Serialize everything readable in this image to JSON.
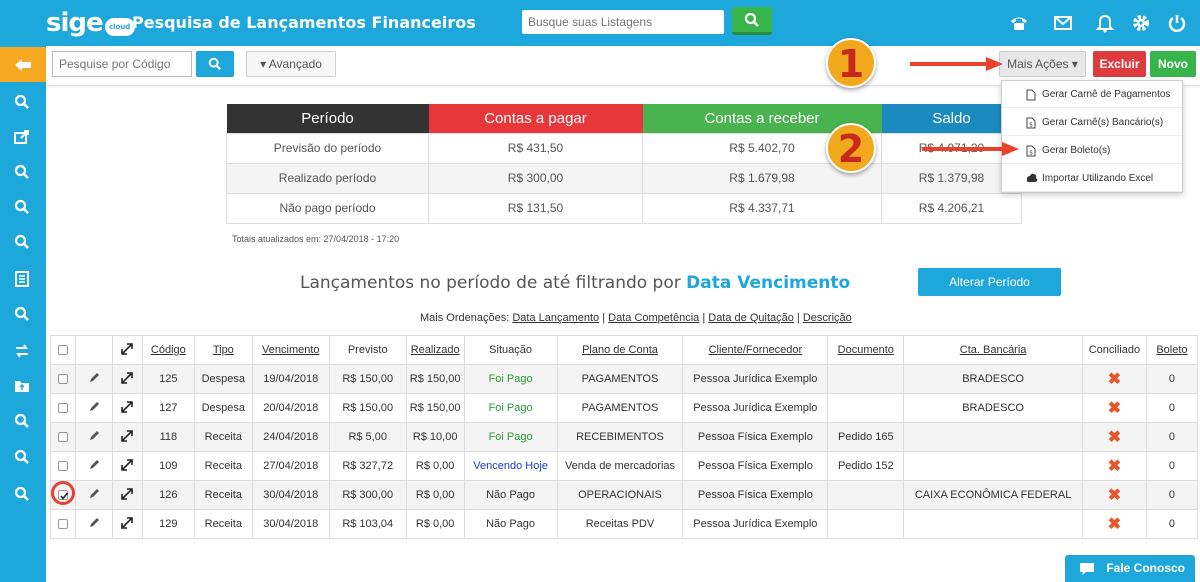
{
  "header": {
    "logo": "sige",
    "logo_badge": "cloud",
    "title": "Pesquisa de Lançamentos Financeiros",
    "search_placeholder": "Busque suas Listagens"
  },
  "toolbar": {
    "code_search_placeholder": "Pesquise por Código",
    "advanced_label": "▾ Avançado",
    "mais_acoes_label": "Mais Ações ▾",
    "excluir_label": "Excluir",
    "novo_label": "Novo"
  },
  "dropdown": {
    "items": [
      {
        "label": "Gerar Carnê de Pagamentos",
        "icon": "file-icon"
      },
      {
        "label": "Gerar Carnê(s) Bancário(s)",
        "icon": "file-dollar-icon"
      },
      {
        "label": "Gerar Boleto(s)",
        "icon": "file-dollar-icon"
      },
      {
        "label": "Importar Utilizando Excel",
        "icon": "cloud-upload-icon"
      }
    ]
  },
  "summary": {
    "headers": [
      "Período",
      "Contas a pagar",
      "Contas a receber",
      "Saldo"
    ],
    "header_colors": [
      "#333333",
      "#e8373a",
      "#48b34f",
      "#1b8bbf"
    ],
    "rows": [
      [
        "Previsão do período",
        "R$ 431,50",
        "R$ 5.402,70",
        "R$ 4.971,20"
      ],
      [
        "Realizado período",
        "R$ 300,00",
        "R$ 1.679,98",
        "R$ 1.379,98"
      ],
      [
        "Não pago período",
        "R$ 131,50",
        "R$ 4.337,71",
        "R$ 4.206,21"
      ]
    ],
    "totais": "Totais atualizados em: 27/04/2018 - 17:20"
  },
  "section": {
    "title_prefix": "Lançamentos no período de até filtrando por",
    "title_highlight": "Data Vencimento",
    "alterar_label": "Alterar Período",
    "ordenacoes_label": "Mais Ordenações:",
    "ordenacoes": [
      "Data Lançamento",
      "Data Competência",
      "Data de Quitação",
      "Descrição"
    ]
  },
  "table": {
    "columns": [
      "Código",
      "Tipo",
      "Vencimento",
      "Previsto",
      "Realizado",
      "Situação",
      "Plano de Conta",
      "Cliente/Fornecedor",
      "Documento",
      "Cta. Bancária",
      "Conciliado",
      "Boleto"
    ],
    "rows": [
      {
        "codigo": "125",
        "tipo": "Despesa",
        "vencimento": "19/04/2018",
        "previsto": "R$ 150,00",
        "realizado": "R$ 150,00",
        "situacao": "Foi Pago",
        "situacao_color": "#2a9d38",
        "plano": "PAGAMENTOS",
        "cliente": "Pessoa Jurídica Exemplo",
        "documento": "",
        "banco": "BRADESCO",
        "boleto": "0",
        "checked": false
      },
      {
        "codigo": "127",
        "tipo": "Despesa",
        "vencimento": "20/04/2018",
        "previsto": "R$ 150,00",
        "realizado": "R$ 150,00",
        "situacao": "Foi Pago",
        "situacao_color": "#2a9d38",
        "plano": "PAGAMENTOS",
        "cliente": "Pessoa Jurídica Exemplo",
        "documento": "",
        "banco": "BRADESCO",
        "boleto": "0",
        "checked": false
      },
      {
        "codigo": "118",
        "tipo": "Receita",
        "vencimento": "24/04/2018",
        "previsto": "R$ 5,00",
        "realizado": "R$ 10,00",
        "situacao": "Foi Pago",
        "situacao_color": "#2a9d38",
        "plano": "RECEBIMENTOS",
        "cliente": "Pessoa Física Exemplo",
        "documento": "Pedido 165",
        "banco": "",
        "boleto": "0",
        "checked": false
      },
      {
        "codigo": "109",
        "tipo": "Receita",
        "vencimento": "27/04/2018",
        "previsto": "R$ 327,72",
        "realizado": "R$ 0,00",
        "situacao": "Vencendo Hoje",
        "situacao_color": "#1a3cc4",
        "plano": "Venda de mercadorias",
        "cliente": "Pessoa Física Exemplo",
        "documento": "Pedido 152",
        "banco": "",
        "boleto": "0",
        "checked": false
      },
      {
        "codigo": "126",
        "tipo": "Receita",
        "vencimento": "30/04/2018",
        "previsto": "R$ 300,00",
        "realizado": "R$ 0,00",
        "situacao": "Não Pago",
        "situacao_color": "#333333",
        "plano": "OPERACIONAIS",
        "cliente": "Pessoa Física Exemplo",
        "documento": "",
        "banco": "CAIXA ECONÔMICA FEDERAL",
        "boleto": "0",
        "checked": true
      },
      {
        "codigo": "129",
        "tipo": "Receita",
        "vencimento": "30/04/2018",
        "previsto": "R$ 103,04",
        "realizado": "R$ 0,00",
        "situacao": "Não Pago",
        "situacao_color": "#333333",
        "plano": "Receitas PDV",
        "cliente": "Pessoa Jurídica Exemplo",
        "documento": "",
        "banco": "",
        "boleto": "0",
        "checked": false
      }
    ]
  },
  "annotations": {
    "badge_1": "1",
    "badge_2": "2"
  },
  "fale_conosco": "Fale Conosco"
}
